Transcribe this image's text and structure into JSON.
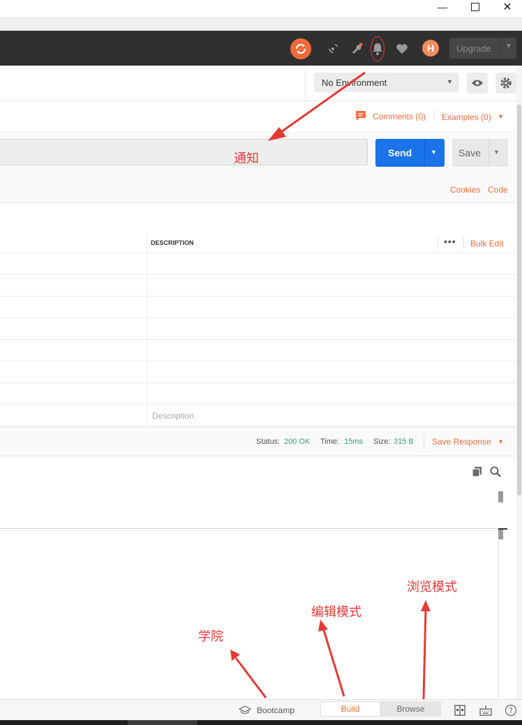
{
  "header": {
    "upgrade_label": "Upgrade",
    "avatar_initial": "H"
  },
  "environment": {
    "selected": "No Environment"
  },
  "request": {
    "comments_label": "Comments (0)",
    "examples_label": "Examples (0)",
    "send_label": "Send",
    "save_label": "Save",
    "cookies_label": "Cookies",
    "code_label": "Code"
  },
  "params": {
    "col_description": "DESCRIPTION",
    "bulk_edit_label": "Bulk Edit",
    "description_placeholder": "Description"
  },
  "response": {
    "status_label": "Status:",
    "status_value": "200 OK",
    "time_label": "Time:",
    "time_value": "15ms",
    "size_label": "Size:",
    "size_value": "315 B",
    "save_response_label": "Save Response"
  },
  "statusbar": {
    "bootcamp_label": "Bootcamp",
    "build_label": "Build",
    "browse_label": "Browse"
  },
  "annotations": {
    "notify": "通知",
    "academy": "学院",
    "edit_mode": "编辑模式",
    "browse_mode": "浏览模式"
  },
  "colors": {
    "accent": "#f26b3a",
    "send": "#1a73e8",
    "status_ok": "#2fa66a",
    "annotation": "#e53935"
  }
}
